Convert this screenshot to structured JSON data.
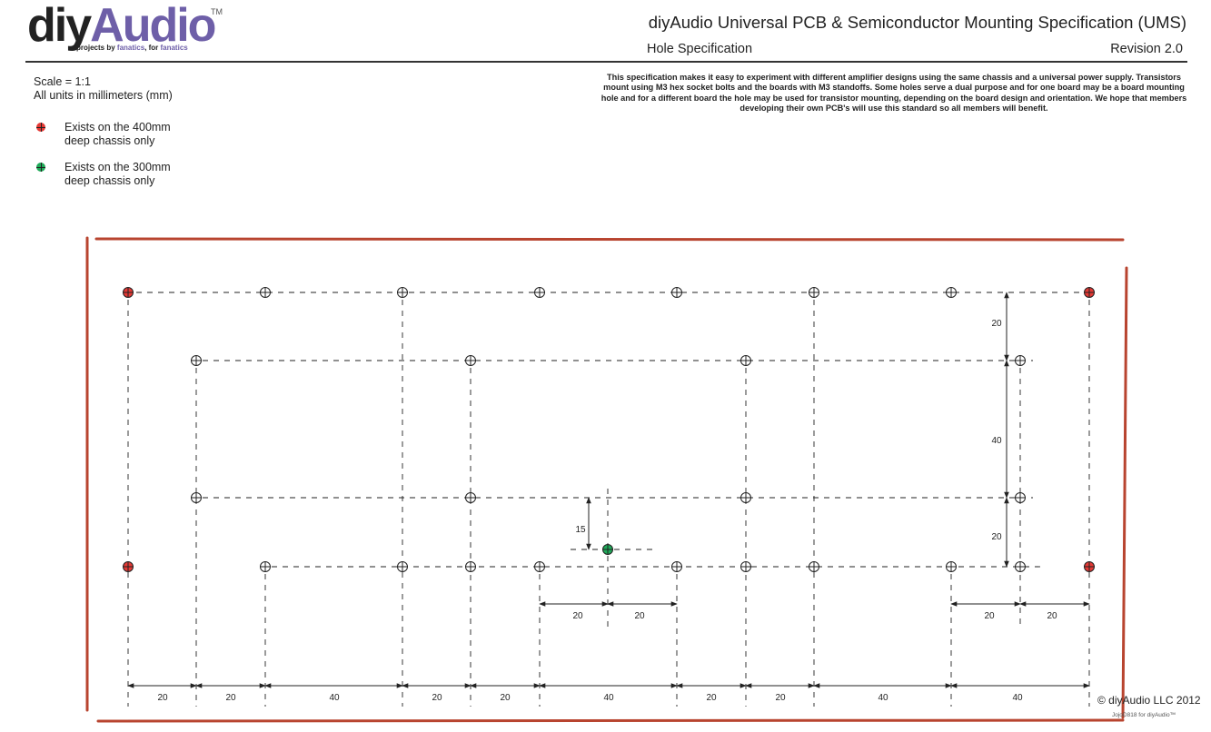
{
  "header": {
    "logo_diy": "diy",
    "logo_audio": "Audio",
    "trademark": "TM",
    "tagline_prefix": "projects by ",
    "tagline_fanatics1": "fanatics",
    "tagline_mid": ", for ",
    "tagline_fanatics2": "fanatics",
    "title": "diyAudio Universal PCB & Semiconductor Mounting Specification (UMS)",
    "subtitle": "Hole Specification",
    "revision": "Revision 2.0"
  },
  "info": {
    "scale": "Scale = 1:1",
    "units": "All units in millimeters (mm)",
    "description": "This specification makes it easy to experiment with different amplifier designs using the same chassis and a universal power supply. Transistors mount using M3 hex socket bolts and the boards with M3 standoffs. Some holes serve a dual purpose and for one board may be a board mounting hole and for a different board the hole may be used for transistor mounting, depending on the board design and orientation. We hope that members developing their own PCB's will use this standard so all members will benefit."
  },
  "legend": [
    {
      "line1": "Exists on the 400mm",
      "line2": "deep chassis only",
      "color": "#e53935"
    },
    {
      "line1": "Exists on the 300mm",
      "line2": "deep chassis only",
      "color": "#1faa59"
    }
  ],
  "colors": {
    "frame": "#b8442f",
    "hole_400": "#e53935",
    "hole_300": "#1faa59",
    "line": "#222222"
  },
  "dimensions": {
    "bottom_chain": [
      "20",
      "20",
      "40",
      "20",
      "20",
      "40",
      "20",
      "20",
      "40",
      "40"
    ],
    "center_pair": [
      "20",
      "20"
    ],
    "right_pair": [
      "20",
      "20"
    ],
    "vertical_right": [
      "20",
      "40",
      "20"
    ],
    "vertical_center": "15"
  },
  "footer": {
    "copyright": "© diyAudio LLC 2012",
    "credit": "JojoD818 for diyAudio™"
  }
}
